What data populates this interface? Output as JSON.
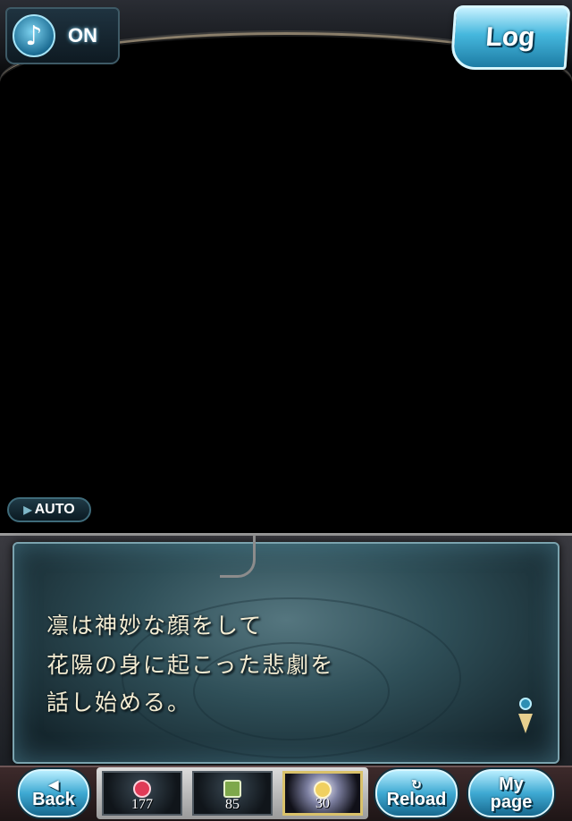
{
  "bgm": {
    "icon": "music-note-icon",
    "state": "ON"
  },
  "log": {
    "label": "Log"
  },
  "auto": {
    "label": "AUTO"
  },
  "dialogue": {
    "lines": [
      "凛は神妙な顔をして",
      "花陽の身に起こった悲劇を",
      "話し始める。"
    ],
    "next_marker_icon": "next-arrow-icon"
  },
  "nav": {
    "back": {
      "icon": "triangle-left-icon",
      "label": "Back"
    },
    "reload": {
      "icon": "reload-icon",
      "label": "Reload"
    },
    "mypage": {
      "line1": "My",
      "line2": "page"
    }
  },
  "items": [
    {
      "icon": "red-gem-icon",
      "color": "#e03a57",
      "count": "177"
    },
    {
      "icon": "green-cube-icon",
      "color": "#7ea84b",
      "count": "85"
    },
    {
      "icon": "gold-orb-icon",
      "color": "#f0d060",
      "count": "30"
    }
  ]
}
